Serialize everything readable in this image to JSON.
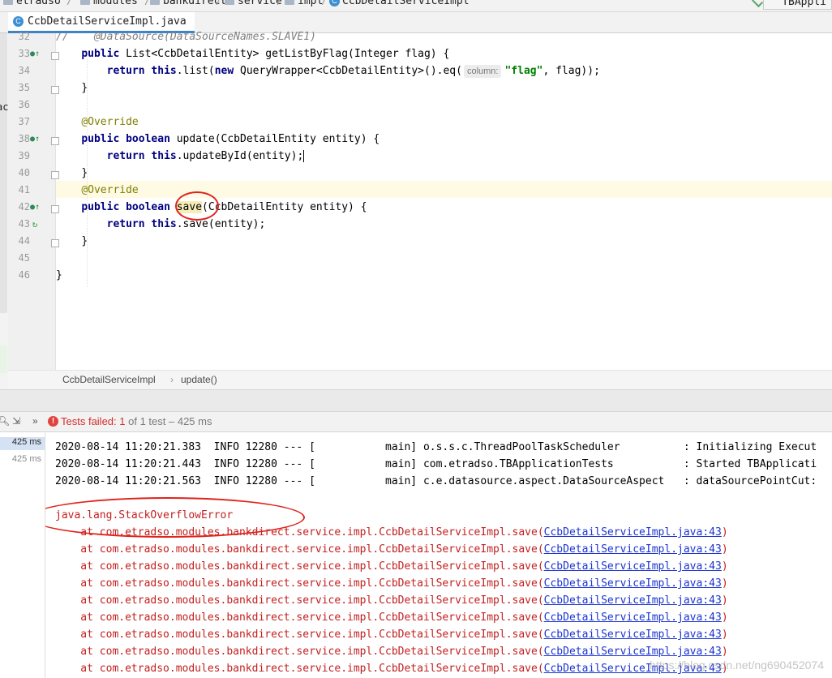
{
  "breadcrumb": {
    "items": [
      "etradso",
      "modules",
      "bankdirect",
      "service",
      "impl",
      "CcbDetailServiceImpl"
    ],
    "run_config": "TBAppli"
  },
  "editor": {
    "tab_title": "CcbDetailServiceImpl.java",
    "left_fragment": "ac",
    "lines": [
      {
        "n": "32"
      },
      {
        "n": "33"
      },
      {
        "n": "34"
      },
      {
        "n": "35"
      },
      {
        "n": "36"
      },
      {
        "n": "37"
      },
      {
        "n": "38"
      },
      {
        "n": "39"
      },
      {
        "n": "40"
      },
      {
        "n": "41"
      },
      {
        "n": "42"
      },
      {
        "n": "43"
      },
      {
        "n": "44"
      },
      {
        "n": "45"
      },
      {
        "n": "46"
      }
    ],
    "code": {
      "l32": "//    @DataSource(DataSourceNames.SLAVE1)",
      "l33_kw": "public",
      "l33_rest": " List<CcbDetailEntity> getListByFlag(Integer flag) {",
      "l34_kw1": "return",
      "l34_kw2": "this",
      "l34_mid": ".list(",
      "l34_kw3": "new",
      "l34_rest": " QueryWrapper<CcbDetailEntity>().eq(",
      "l34_hint": "column:",
      "l34_str": "\"flag\"",
      "l34_end": ", flag));",
      "l35": "}",
      "l37": "@Override",
      "l38_kw1": "public",
      "l38_kw2": "boolean",
      "l38_rest": " update(CcbDetailEntity entity) {",
      "l39_kw1": "return",
      "l39_kw2": "this",
      "l39_rest": ".updateById(entity);",
      "l40": "}",
      "l41": "@Override",
      "l42_kw1": "public",
      "l42_kw2": "boolean",
      "l42_save": "save",
      "l42_rest": "(CcbDetailEntity entity) {",
      "l43_kw1": "return",
      "l43_kw2": "this",
      "l43_rest": ".save(entity);",
      "l44": "}",
      "l46": "}"
    },
    "footer": {
      "class": "CcbDetailServiceImpl",
      "method": "update()"
    }
  },
  "run": {
    "status_label": "Tests failed:",
    "failed_count": "1",
    "status_rest": "of 1 test – 425 ms",
    "tree": {
      "root_time": "425 ms",
      "child_time": "425 ms"
    },
    "logs": [
      "2020-08-14 11:20:21.383  INFO 12280 --- [           main] o.s.s.c.ThreadPoolTaskScheduler          : Initializing Execut",
      "2020-08-14 11:20:21.443  INFO 12280 --- [           main] com.etradso.TBApplicationTests           : Started TBApplicati",
      "2020-08-14 11:20:21.563  INFO 12280 --- [           main] c.e.datasource.aspect.DataSourceAspect   : dataSourcePointCut:"
    ],
    "error": "java.lang.StackOverflowError",
    "stack_prefix": "    at com.etradso.modules.bankdirect.service.impl.CcbDetailServiceImpl.save(",
    "stack_link": "CcbDetailServiceImpl.java:43",
    "stack_suffix": ")",
    "stack_repeat": 9,
    "watermark": "https://blog.csdn.net/ng690452074"
  }
}
